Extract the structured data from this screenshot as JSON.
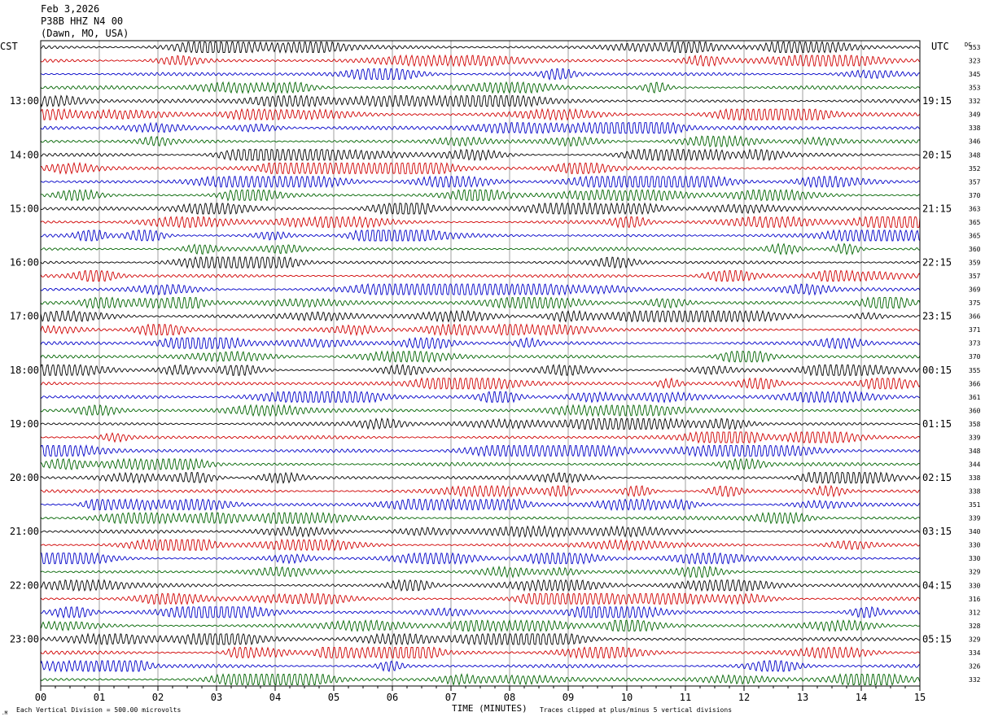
{
  "header": {
    "date": "Feb 3,2026",
    "station": "P38B HHZ N4 00",
    "location": "(Dawn, MO, USA)"
  },
  "axis": {
    "left_label": "CST",
    "right_label": "UTC",
    "dc_label": "DC",
    "xlabel": "TIME (MINUTES)",
    "x_ticks": [
      "00",
      "01",
      "02",
      "03",
      "04",
      "05",
      "06",
      "07",
      "08",
      "09",
      "10",
      "11",
      "12",
      "13",
      "14",
      "15"
    ],
    "footer_left": "Each Vertical Division =  500.00 microvolts",
    "footer_right": "Traces clipped at plus/minus 5 vertical divisions"
  },
  "chart_data": {
    "type": "line",
    "title": "",
    "xlabel": "TIME (MINUTES)",
    "xlim": [
      0,
      15
    ],
    "trace_count": 48,
    "minutes_per_trace": 15,
    "trace_colors": [
      "#000000",
      "#d00000",
      "#0000c8",
      "#006400"
    ],
    "hour_labels_cst": [
      "13:00",
      "14:00",
      "15:00",
      "16:00",
      "17:00",
      "18:00",
      "19:00",
      "20:00",
      "21:00",
      "22:00",
      "23:00"
    ],
    "hour_labels_utc": [
      "19:15",
      "20:15",
      "21:15",
      "22:15",
      "23:15",
      "00:15",
      "01:15",
      "02:15",
      "03:15",
      "04:15",
      "05:15"
    ],
    "dc_offsets": [
      353,
      323,
      345,
      353,
      332,
      349,
      338,
      346,
      348,
      352,
      357,
      370,
      363,
      365,
      365,
      360,
      359,
      357,
      369,
      375,
      366,
      371,
      373,
      370,
      355,
      366,
      361,
      360,
      358,
      339,
      348,
      344,
      338,
      338,
      351,
      339,
      340,
      330,
      330,
      329,
      330,
      316,
      312,
      328,
      329,
      334,
      326,
      332
    ]
  }
}
